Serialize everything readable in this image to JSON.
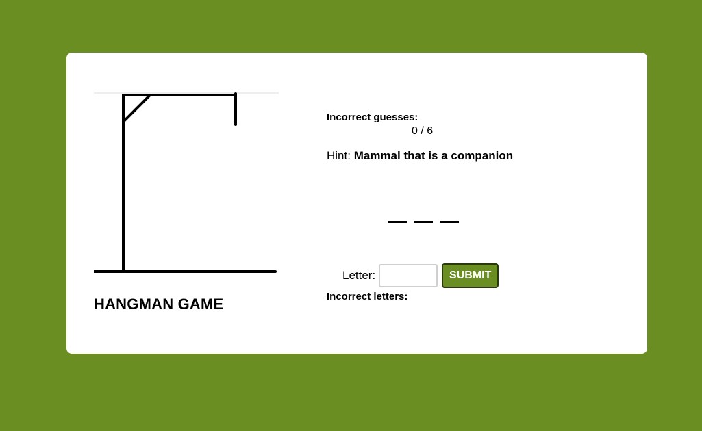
{
  "game": {
    "title": "HANGMAN GAME",
    "incorrect_guesses_label": "Incorrect guesses:",
    "incorrect_guesses_count": "0 / 6",
    "incorrect_guesses": 0,
    "max_guesses": 6,
    "hint_label": "Hint:",
    "hint_text": "Mammal that is a companion",
    "word_blanks": [
      "",
      "",
      ""
    ],
    "letter_label": "Letter:",
    "letter_input_value": "",
    "submit_label": "SUBMIT",
    "incorrect_letters_label": "Incorrect letters:",
    "incorrect_letters": ""
  },
  "colors": {
    "background": "#6b8e23",
    "card": "#ffffff",
    "button": "#6b8e23",
    "button_text": "#ffffff"
  }
}
